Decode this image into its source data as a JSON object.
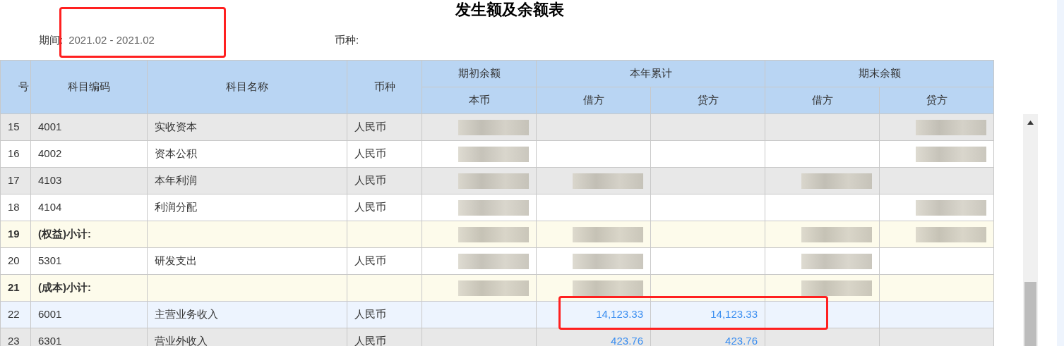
{
  "title": "发生额及余额表",
  "period": {
    "label": "期间:",
    "value": "2021.02 - 2021.02",
    "highlighted": true
  },
  "currency": {
    "label": "币种:"
  },
  "table": {
    "columns": [
      {
        "label": "号"
      },
      {
        "label": "科目编码"
      },
      {
        "label": "科目名称"
      },
      {
        "label": "币种"
      }
    ],
    "groups": [
      {
        "label": "期初余额",
        "sub": [
          "本币"
        ]
      },
      {
        "label": "本年累计",
        "sub": [
          "借方",
          "贷方"
        ]
      },
      {
        "label": "期末余额",
        "sub": [
          "借方",
          "贷方"
        ]
      }
    ],
    "rows": [
      {
        "kind": "normal",
        "shaded": true,
        "selected": false,
        "cells": [
          {
            "text": "15"
          },
          {
            "text": "4001"
          },
          {
            "text": "实收资本"
          },
          {
            "text": "人民币"
          },
          {
            "redacted": true
          },
          {},
          {},
          {},
          {
            "redacted": true
          }
        ]
      },
      {
        "kind": "normal",
        "shaded": false,
        "selected": false,
        "cells": [
          {
            "text": "16"
          },
          {
            "text": "4002"
          },
          {
            "text": "资本公积"
          },
          {
            "text": "人民币"
          },
          {
            "redacted": true
          },
          {},
          {},
          {},
          {
            "redacted": true
          }
        ]
      },
      {
        "kind": "normal",
        "shaded": true,
        "selected": false,
        "cells": [
          {
            "text": "17"
          },
          {
            "text": "4103"
          },
          {
            "text": "本年利润"
          },
          {
            "text": "人民币"
          },
          {
            "redacted": true
          },
          {
            "redacted": true
          },
          {},
          {
            "redacted": true
          },
          {}
        ]
      },
      {
        "kind": "normal",
        "shaded": false,
        "selected": false,
        "cells": [
          {
            "text": "18"
          },
          {
            "text": "4104"
          },
          {
            "text": "利润分配"
          },
          {
            "text": "人民币"
          },
          {
            "redacted": true
          },
          {},
          {},
          {},
          {
            "redacted": true
          }
        ]
      },
      {
        "kind": "subtotal",
        "selected": false,
        "cells": [
          {
            "text": "19"
          },
          {
            "text": "(权益)小计:"
          },
          {},
          {},
          {
            "redacted": true
          },
          {
            "redacted": true
          },
          {},
          {
            "redacted": true
          },
          {
            "redacted": true
          }
        ]
      },
      {
        "kind": "normal",
        "shaded": false,
        "selected": false,
        "cells": [
          {
            "text": "20"
          },
          {
            "text": "5301"
          },
          {
            "text": "研发支出"
          },
          {
            "text": "人民币"
          },
          {
            "redacted": true
          },
          {
            "redacted": true
          },
          {},
          {
            "redacted": true
          },
          {}
        ]
      },
      {
        "kind": "subtotal",
        "selected": false,
        "cells": [
          {
            "text": "21"
          },
          {
            "text": "(成本)小计:"
          },
          {},
          {},
          {
            "redacted": true
          },
          {
            "redacted": true
          },
          {},
          {
            "redacted": true
          },
          {}
        ]
      },
      {
        "kind": "normal",
        "selected": true,
        "marked": true,
        "cells": [
          {
            "text": "22"
          },
          {
            "text": "6001"
          },
          {
            "text": "主营业务收入"
          },
          {
            "text": "人民币"
          },
          {},
          {
            "text": "14,123.33"
          },
          {
            "text": "14,123.33"
          },
          {},
          {}
        ]
      },
      {
        "kind": "normal",
        "shaded": true,
        "selected": false,
        "cells": [
          {
            "text": "23"
          },
          {
            "text": "6301"
          },
          {
            "text": "营业外收入"
          },
          {
            "text": "人民币"
          },
          {},
          {
            "text": "423.76"
          },
          {
            "text": "423.76"
          },
          {},
          {}
        ]
      }
    ]
  }
}
